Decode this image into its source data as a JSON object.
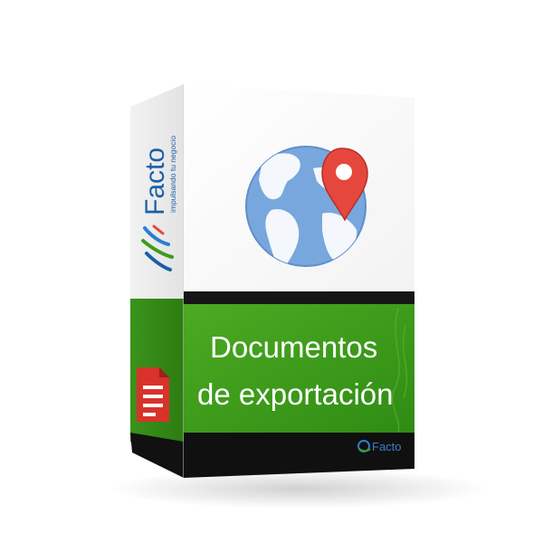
{
  "product": {
    "brand": "Facto",
    "tagline": "impulsando tu negocio",
    "title_line1": "Documentos",
    "title_line2": "de exportación",
    "footer_brand": "Facto"
  },
  "icons": {
    "hero": "globe-with-map-pin-icon",
    "side_logo": "facto-swoosh-logo",
    "side_document": "document-icon",
    "footer_logo": "facto-small-logo"
  },
  "colors": {
    "green": "#3e9e1c",
    "green_dark": "#2f7e13",
    "black_band": "#111111",
    "globe_ocean": "#78a7dd",
    "globe_land": "#f4f7fb",
    "pin_red": "#e5473d",
    "document_red": "#d8322b",
    "brand_blue": "#1b5fa8"
  }
}
